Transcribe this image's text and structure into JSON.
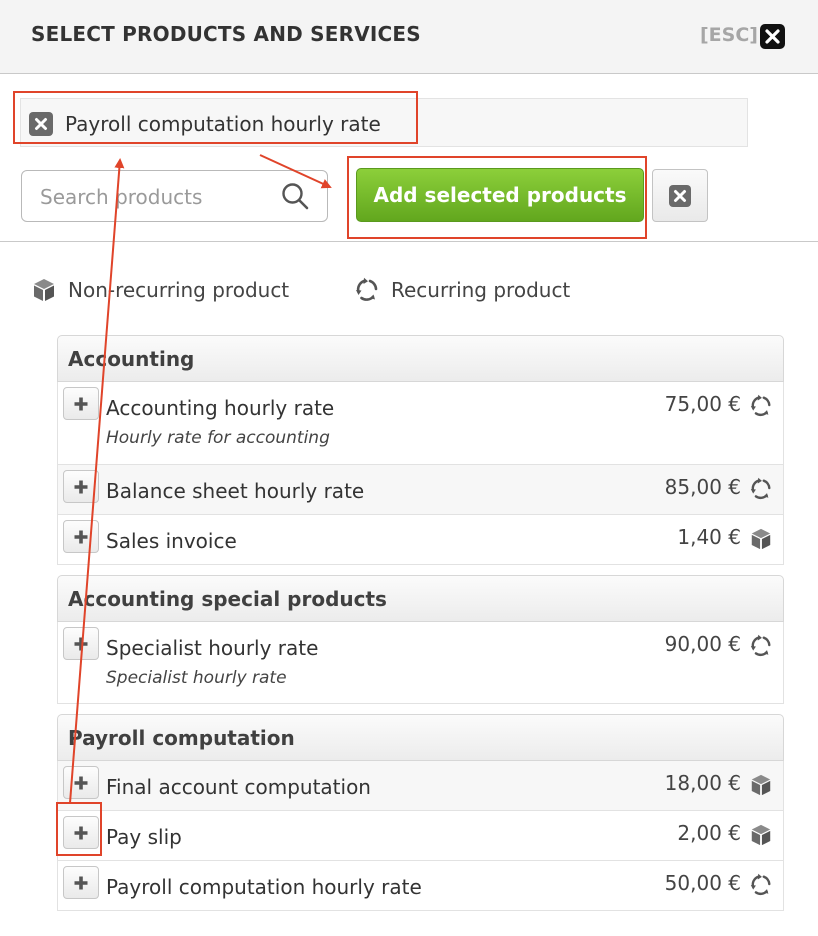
{
  "header": {
    "title": "SELECT PRODUCTS AND SERVICES",
    "esc_label": "[ESC]"
  },
  "selected": {
    "items": [
      {
        "label": "Payroll computation hourly rate"
      }
    ]
  },
  "search": {
    "placeholder": "Search products",
    "value": ""
  },
  "actions": {
    "add_label": "Add selected products"
  },
  "legend": {
    "non_recurring": "Non-recurring product",
    "recurring": "Recurring product"
  },
  "groups": [
    {
      "title": "Accounting",
      "products": [
        {
          "name": "Accounting hourly rate",
          "description": "Hourly rate for accounting",
          "price": "75,00 €",
          "type": "recurring"
        },
        {
          "name": "Balance sheet hourly rate",
          "description": "",
          "price": "85,00 €",
          "type": "recurring"
        },
        {
          "name": "Sales invoice",
          "description": "",
          "price": "1,40 €",
          "type": "non-recurring"
        }
      ]
    },
    {
      "title": "Accounting special products",
      "products": [
        {
          "name": "Specialist hourly rate",
          "description": "Specialist hourly rate",
          "price": "90,00 €",
          "type": "recurring"
        }
      ]
    },
    {
      "title": "Payroll computation",
      "products": [
        {
          "name": "Final account computation",
          "description": "",
          "price": "18,00 €",
          "type": "non-recurring"
        },
        {
          "name": "Pay slip",
          "description": "",
          "price": "2,00 €",
          "type": "non-recurring"
        },
        {
          "name": "Payroll computation hourly rate",
          "description": "",
          "price": "50,00 €",
          "type": "recurring"
        }
      ]
    }
  ],
  "colors": {
    "accent_green": "#6fb52a",
    "annotation_red": "#e0442a"
  }
}
